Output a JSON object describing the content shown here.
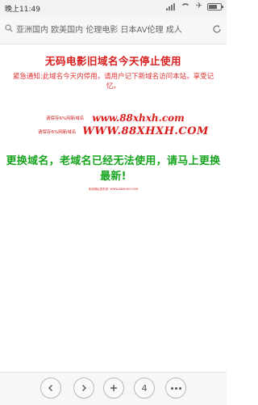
{
  "status_bar": {
    "time": "晚上11:49"
  },
  "url_bar": {
    "text": "亚洲国内 欧美国内 伦理电影 日本AV伦理 成人"
  },
  "content": {
    "title": "无码电影旧域名今天停止使用",
    "notice": "紧急通知:此域名今天内停用，请用户记下新域名访问本站，享受记忆。",
    "domain_label_1": "请保存6%网新域名",
    "domain_url_1": "www.88xhxh.com",
    "domain_label_2": "请保存6%网新域名",
    "domain_url_2": "WWW.88XHXH.COM",
    "warning": "更换域名，老域名已经无法使用，请马上更换最新!",
    "footnote": "本站网址发布页: WWW.88XHXH.COM"
  },
  "toolbar": {
    "tab_count": "4"
  },
  "colors": {
    "title_red": "#d91c1c",
    "warning_green": "#17a51f"
  }
}
